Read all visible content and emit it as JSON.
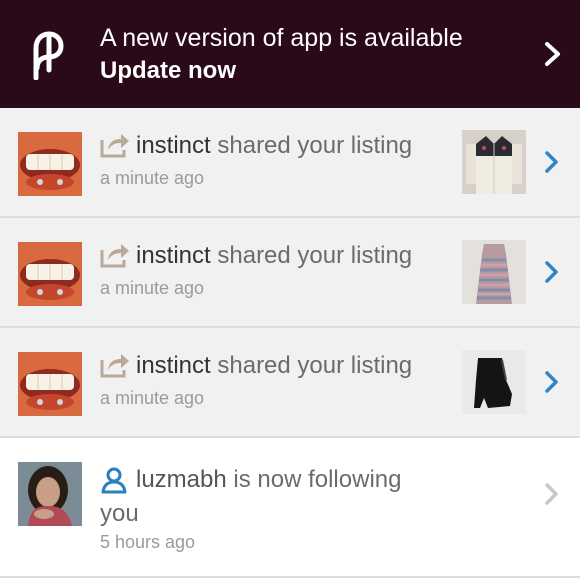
{
  "banner": {
    "title": "A new version of app is available",
    "cta": "Update now",
    "background_color": "#2a0a19",
    "logo_icon": "poshmark-logo-icon",
    "chevron_icon": "chevron-right-icon"
  },
  "notifications": [
    {
      "user": "instinct",
      "action": " shared your listing",
      "time": "a minute ago",
      "icon": "share-icon",
      "thumbnail": "western-shirt"
    },
    {
      "user": "instinct",
      "action": " shared your listing",
      "time": "a minute ago",
      "icon": "share-icon",
      "thumbnail": "patterned-dress"
    },
    {
      "user": "instinct",
      "action": " shared your listing",
      "time": "a minute ago",
      "icon": "share-icon",
      "thumbnail": "black-wedge-bootie"
    }
  ],
  "follow": {
    "user": "luzmabh",
    "action_line1": " is now following",
    "action_line2": "you",
    "time": "5 hours ago",
    "icon": "follow-user-icon"
  },
  "colors": {
    "row_bg": "#f1f1f1",
    "accent_chevron": "#2e86c8",
    "muted_chevron": "#c7c7c7",
    "icon_blue": "#2a7fbf"
  }
}
